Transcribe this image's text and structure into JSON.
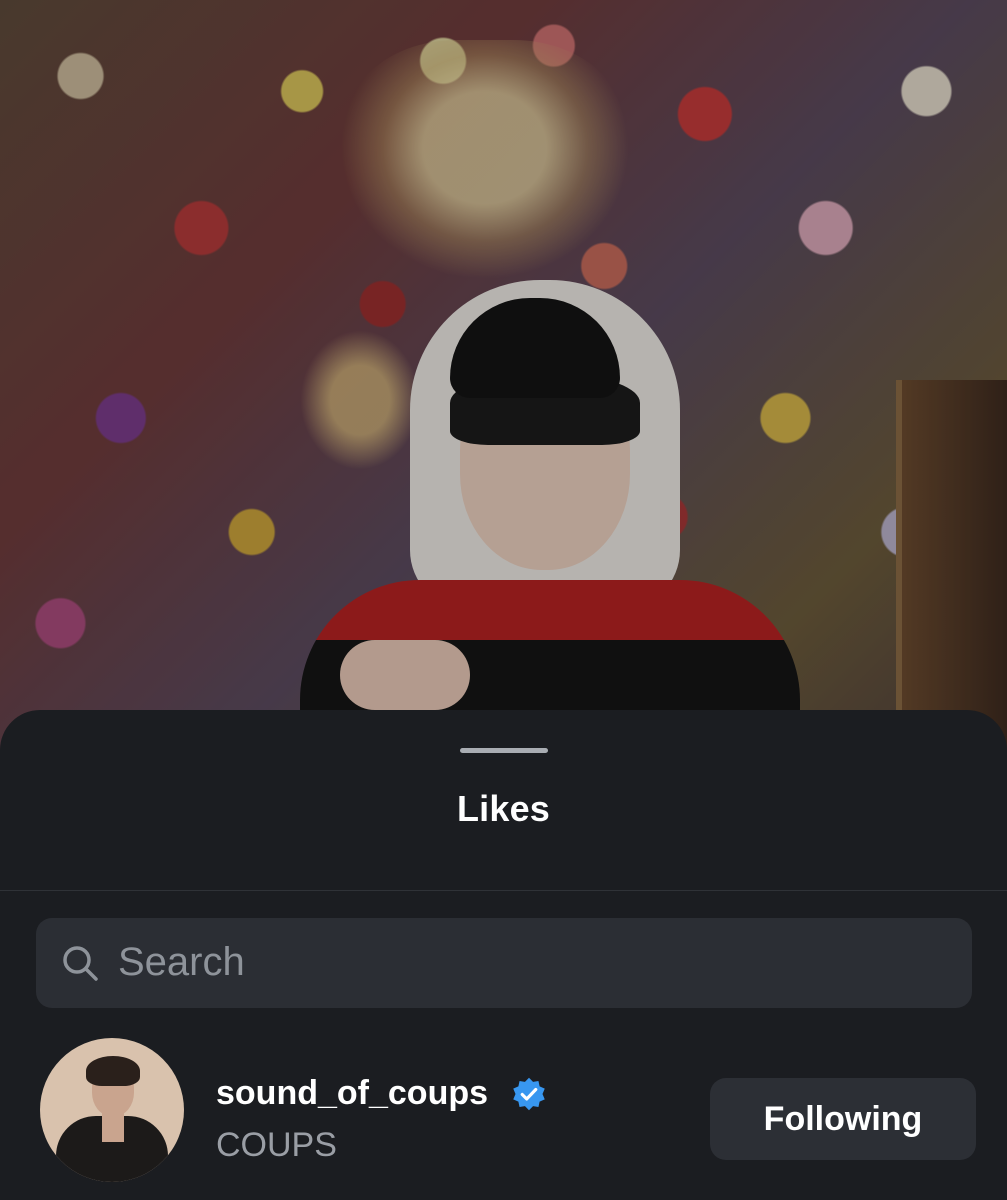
{
  "sheet": {
    "title": "Likes"
  },
  "search": {
    "placeholder": "Search",
    "icon": "search-icon"
  },
  "likes": [
    {
      "username": "sound_of_coups",
      "full_name": "COUPS",
      "verified": true,
      "button_label": "Following"
    }
  ],
  "colors": {
    "sheet_background": "#1b1d21",
    "search_background": "#2b2e34",
    "button_background": "#2c2f35",
    "verified_blue": "#3897f0"
  }
}
